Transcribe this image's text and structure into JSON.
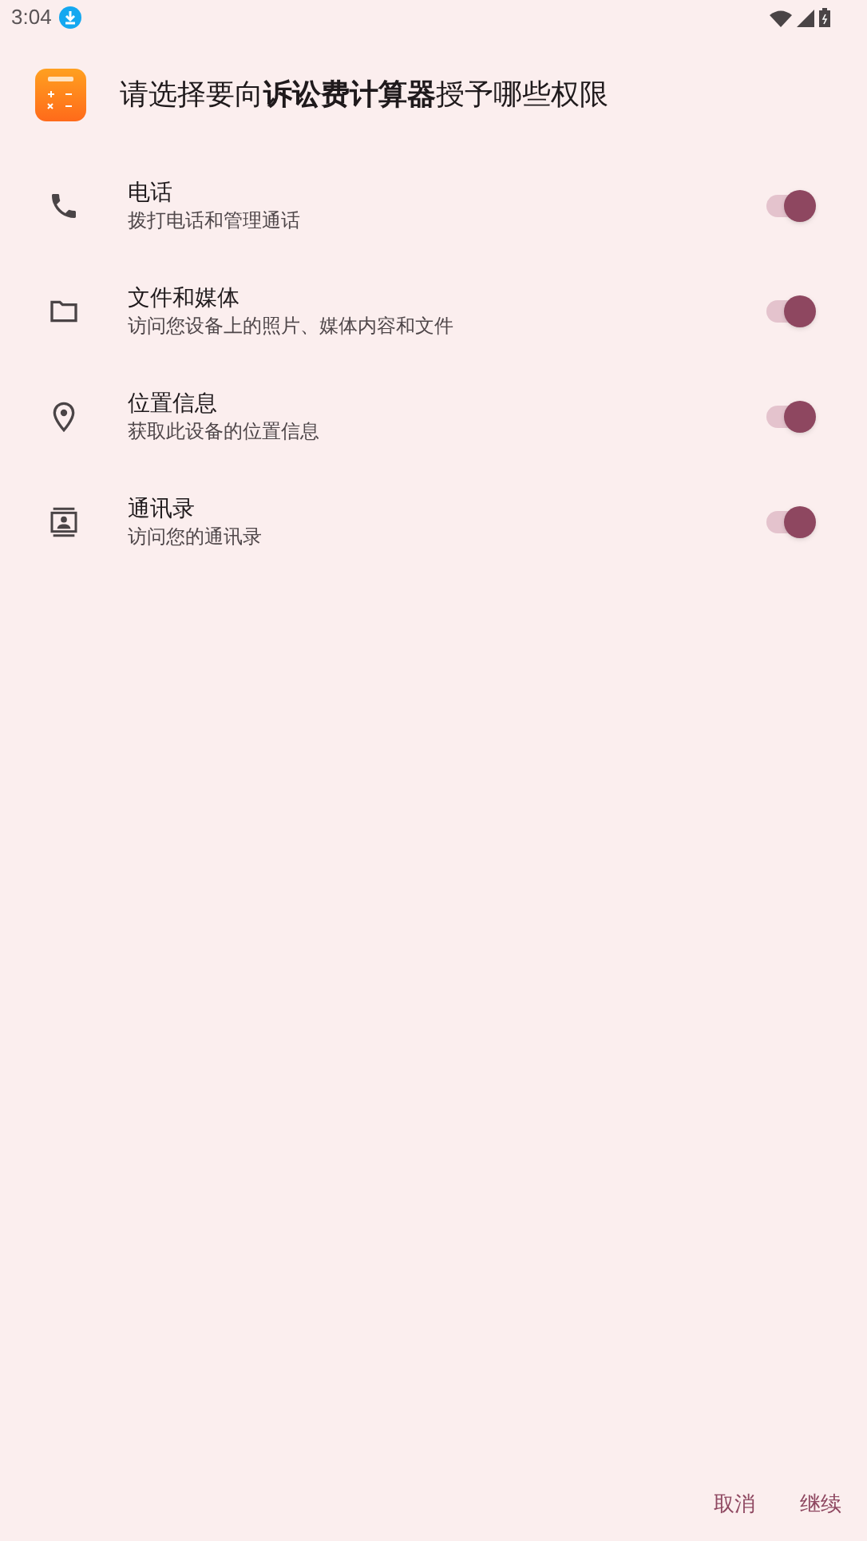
{
  "status_bar": {
    "time": "3:04"
  },
  "title": "请选择要向**诉讼费计算器**授予哪些权限",
  "permissions": [
    {
      "kind": "phone",
      "name": "电话",
      "description": "拨打电话和管理通话",
      "on": true
    },
    {
      "kind": "folder",
      "name": "文件和媒体",
      "description": "访问您设备上的照片、媒体内容和文件",
      "on": true
    },
    {
      "kind": "location",
      "name": "位置信息",
      "description": "获取此设备的位置信息",
      "on": true
    },
    {
      "kind": "contacts",
      "name": "通讯录",
      "description": "访问您的通讯录",
      "on": true
    }
  ],
  "buttons": [
    "取消",
    "继续"
  ]
}
